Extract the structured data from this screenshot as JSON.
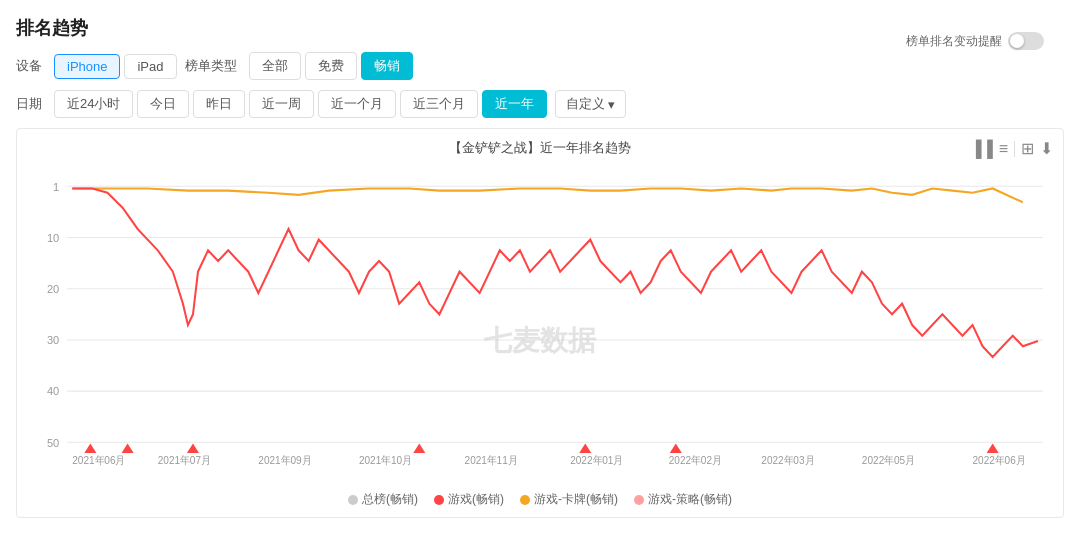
{
  "page": {
    "title": "排名趋势",
    "alert_label": "榜单排名变动提醒"
  },
  "device_filter": {
    "label": "设备",
    "options": [
      "iPhone",
      "iPad"
    ],
    "active": "iPhone"
  },
  "chart_type_filter": {
    "label": "榜单类型",
    "options": [
      "全部",
      "免费",
      "畅销"
    ],
    "active": "畅销"
  },
  "date_filter": {
    "label": "日期",
    "options": [
      "近24小时",
      "今日",
      "昨日",
      "近一周",
      "近一个月",
      "近三个月",
      "近一年"
    ],
    "active": "近一年",
    "custom": "自定义"
  },
  "chart": {
    "title": "【金铲铲之战】近一年排名趋势",
    "x_labels": [
      "2021年06月",
      "2021年07月",
      "2021年09月",
      "2021年10月",
      "2021年11月",
      "2022年01月",
      "2022年02月",
      "2022年03月",
      "2022年05月",
      "2022年06月"
    ],
    "y_labels": [
      "1",
      "10",
      "20",
      "30",
      "40",
      "50"
    ],
    "watermark": "七麦数据"
  },
  "legend": {
    "items": [
      {
        "label": "总榜(畅销)",
        "color": "#ccc"
      },
      {
        "label": "游戏(畅销)",
        "color": "#f44"
      },
      {
        "label": "游戏-卡牌(畅销)",
        "color": "#f90"
      },
      {
        "label": "游戏-策略(畅销)",
        "color": "#f44"
      }
    ]
  },
  "icons": {
    "bar_chart": "▐",
    "list": "≡",
    "image": "⊞",
    "download": "⬇",
    "chevron": "▾"
  }
}
